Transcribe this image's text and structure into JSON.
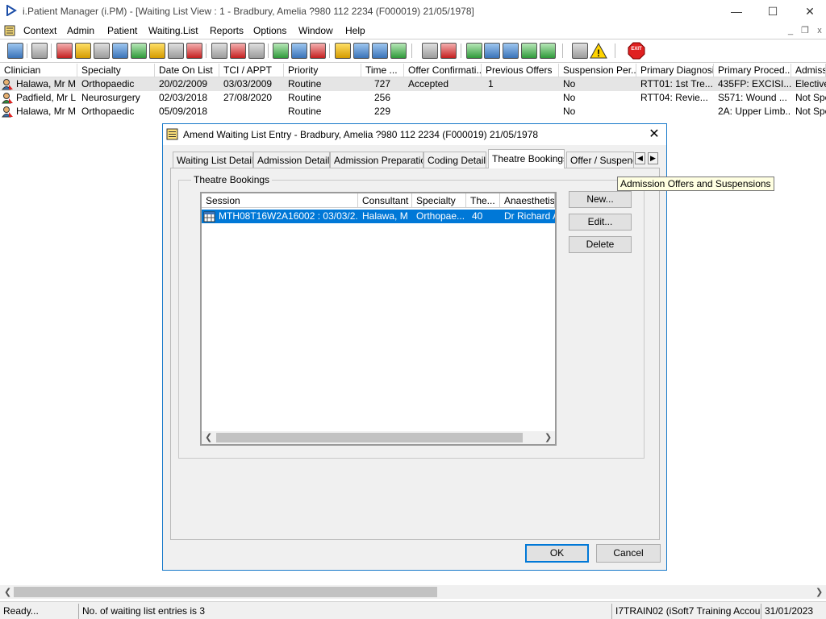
{
  "window": {
    "title": "i.Patient Manager (i.PM) - [Waiting List View : 1 - Bradbury, Amelia ?980 112 2234 (F000019) 21/05/1978]",
    "minimize": "—",
    "maximize": "☐",
    "close": "✕"
  },
  "menu": {
    "items": [
      "Context",
      "Admin",
      "Patient",
      "Waiting.List",
      "Reports",
      "Options",
      "Window",
      "Help"
    ],
    "mdi_minimize": "_",
    "mdi_restore": "❐",
    "mdi_close": "x"
  },
  "toolbar": {
    "exit_label": "EXIT"
  },
  "list": {
    "columns": [
      "Clinician",
      "Specialty",
      "Date On List",
      "TCI / APPT",
      "Priority",
      "Time ...",
      "Offer Confirmati...",
      "Previous Offers",
      "Suspension Per...",
      "Primary Diagnosis",
      "Primary Proced...",
      "Admissi"
    ],
    "rows": [
      [
        "Halawa, Mr M",
        "Orthopaedic",
        "20/02/2009",
        "03/03/2009",
        "Routine",
        "727",
        "Accepted",
        "1",
        "No",
        "RTT01: 1st Tre...",
        "435FP: EXCISI...",
        "Elective"
      ],
      [
        "Padfield, Mr L",
        "Neurosurgery",
        "02/03/2018",
        "27/08/2020",
        "Routine",
        "256",
        "",
        "",
        "No",
        "RTT04: Revie...",
        "S571: Wound ...",
        "Not Spe"
      ],
      [
        "Halawa, Mr M",
        "Orthopaedic",
        "05/09/2018",
        "",
        "Routine",
        "229",
        "",
        "",
        "No",
        "",
        "2A: Upper Limb...",
        "Not Spe"
      ]
    ]
  },
  "dialog": {
    "title": "Amend Waiting List Entry - Bradbury, Amelia ?980 112 2234 (F000019) 21/05/1978",
    "close": "✕",
    "tabs": [
      "Waiting List Details",
      "Admission Details",
      "Admission Preparation",
      "Coding Details",
      "Theatre Bookings",
      "Offer / Suspend"
    ],
    "active_tab": "Theatre Bookings",
    "group_label": "Theatre Bookings",
    "grid": {
      "columns": [
        "Session",
        "Consultant",
        "Specialty",
        "The...",
        "Anaesthetist"
      ],
      "row": [
        "MTH08T16W2A16002 : 03/03/2...",
        "Halawa, M",
        "Orthopae...",
        "40",
        "Dr Richard A"
      ]
    },
    "buttons": {
      "new": "New...",
      "edit": "Edit...",
      "delete": "Delete",
      "ok": "OK",
      "cancel": "Cancel"
    },
    "tooltip": "Admission Offers and Suspensions"
  },
  "status": {
    "ready": "Ready...",
    "entries": "No. of waiting list entries is 3",
    "account": "I7TRAIN02 (iSoft7 Training Account)",
    "date": "31/01/2023"
  },
  "colors": {
    "accent": "#0078d7",
    "dialog_border": "#1779c9"
  }
}
